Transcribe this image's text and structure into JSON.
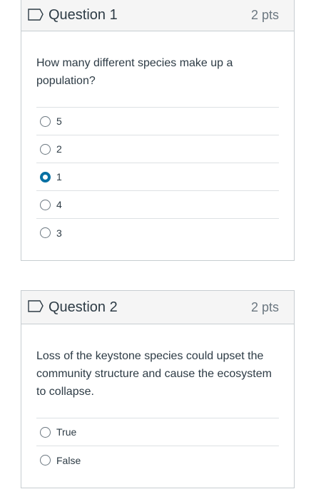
{
  "questions": [
    {
      "title": "Question 1",
      "points": "2 pts",
      "text": "How many different species make up a population?",
      "answers": [
        {
          "label": "5",
          "selected": false
        },
        {
          "label": "2",
          "selected": false
        },
        {
          "label": "1",
          "selected": true
        },
        {
          "label": "4",
          "selected": false
        },
        {
          "label": "3",
          "selected": false
        }
      ]
    },
    {
      "title": "Question 2",
      "points": "2 pts",
      "text": "Loss of the keystone species could upset the community structure and cause the ecosystem to collapse.",
      "answers": [
        {
          "label": "True",
          "selected": false
        },
        {
          "label": "False",
          "selected": false
        }
      ]
    }
  ],
  "colors": {
    "accent": "#0770a3",
    "border": "#c7cdd1",
    "header_bg": "#f5f5f5"
  }
}
